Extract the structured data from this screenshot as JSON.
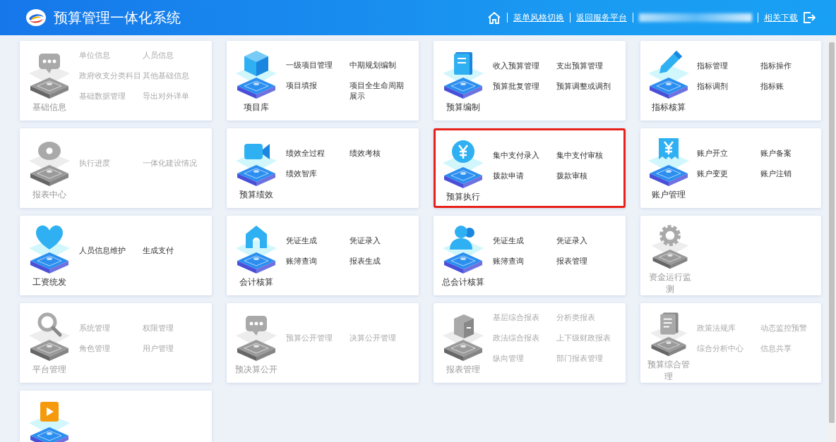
{
  "header": {
    "title": "预算管理一体化系统",
    "links": [
      "菜单风格切换",
      "返回服务平台",
      "相关下载"
    ]
  },
  "cards": [
    {
      "title": "基础信息",
      "kind": "chat",
      "disabled": true,
      "highlighted": false,
      "links": [
        "单位信息",
        "人员信息",
        "政府收支分类科目",
        "其他基础信息",
        "基础数据管理",
        "导出对外详单"
      ]
    },
    {
      "title": "项目库",
      "kind": "cube",
      "disabled": false,
      "highlighted": false,
      "links": [
        "一级项目管理",
        "中期规划编制",
        "项目填报",
        "项目全生命周期展示"
      ]
    },
    {
      "title": "预算编制",
      "kind": "book",
      "disabled": false,
      "highlighted": false,
      "links": [
        "收入预算管理",
        "支出预算管理",
        "预算批复管理",
        "预算调整或调剂"
      ]
    },
    {
      "title": "指标核算",
      "kind": "pencil",
      "disabled": false,
      "highlighted": false,
      "links": [
        "指标管理",
        "指标操作",
        "指标调剂",
        "指标账"
      ]
    },
    {
      "title": "报表中心",
      "kind": "eye",
      "disabled": true,
      "highlighted": false,
      "links": [
        "执行进度",
        "一体化建设情况"
      ]
    },
    {
      "title": "预算绩效",
      "kind": "camera",
      "disabled": false,
      "highlighted": false,
      "links": [
        "绩效全过程",
        "绩效考核",
        "绩效智库"
      ]
    },
    {
      "title": "预算执行",
      "kind": "yen",
      "disabled": false,
      "highlighted": true,
      "links": [
        "集中支付录入",
        "集中支付审核",
        "拨款申请",
        "拨款审核"
      ]
    },
    {
      "title": "账户管理",
      "kind": "receipt",
      "disabled": false,
      "highlighted": false,
      "links": [
        "账户开立",
        "账户备案",
        "账户变更",
        "账户注销"
      ]
    },
    {
      "title": "工资统发",
      "kind": "heart",
      "disabled": false,
      "highlighted": false,
      "links": [
        "人员信息维护",
        "生成支付"
      ]
    },
    {
      "title": "会计核算",
      "kind": "house",
      "disabled": false,
      "highlighted": false,
      "links": [
        "凭证生成",
        "凭证录入",
        "账簿查询",
        "报表生成"
      ]
    },
    {
      "title": "总会计核算",
      "kind": "people",
      "disabled": false,
      "highlighted": false,
      "links": [
        "凭证生成",
        "凭证录入",
        "账簿查询",
        "报表管理"
      ]
    },
    {
      "title": "资金运行监测",
      "kind": "gear",
      "disabled": true,
      "highlighted": false
    },
    {
      "title": "平台管理",
      "kind": "search",
      "disabled": true,
      "highlighted": false,
      "links": [
        "系统管理",
        "权限管理",
        "角色管理",
        "用户管理"
      ]
    },
    {
      "title": "预决算公开",
      "kind": "chat",
      "disabled": true,
      "highlighted": false,
      "links": [
        "预算公开管理",
        "决算公开管理"
      ]
    },
    {
      "title": "报表管理",
      "kind": "box",
      "disabled": true,
      "highlighted": false,
      "links": [
        "基层综合报表",
        "分析类报表",
        "政法综合报表",
        "上下级财政报表",
        "纵向管理",
        "部门报表管理"
      ]
    },
    {
      "title": "预算综合管理",
      "kind": "document",
      "disabled": true,
      "highlighted": false,
      "links": [
        "政策法规库",
        "动态监控预警",
        "综合分析中心",
        "信息共享"
      ]
    },
    {
      "kind": "play",
      "disabled": false,
      "highlighted": false
    }
  ]
}
